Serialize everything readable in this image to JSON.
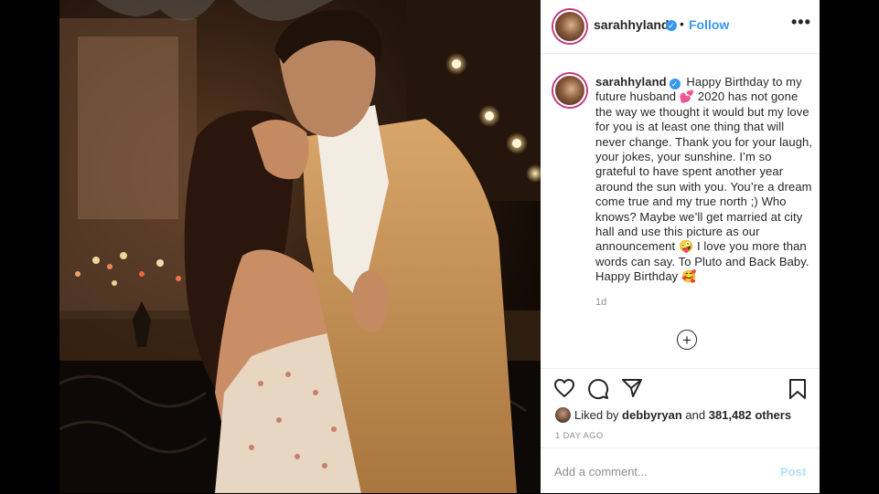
{
  "post": {
    "image_alt": "Couple embracing on a balcony with string lights",
    "next_icon": "chevron-right-icon"
  },
  "header": {
    "username": "sarahhyland",
    "verified_icon": "verified-badge-icon",
    "separator": "•",
    "follow_label": "Follow",
    "more_label": "•••"
  },
  "caption": {
    "username": "sarahhyland",
    "text_part1": " Happy Birthday to my future husband ",
    "emoji1": "💕",
    "text_part2": "  2020 has not gone the way we thought it would but my love for you is at least one thing that will never change. Thank you for your laugh, your jokes, your sunshine. I’m so grateful to have spent another year around the sun with you. You’re a dream come true and my true north ;) Who knows? Maybe we’ll get married at city hall and use this picture as our announcement ",
    "emoji2": "🤪",
    "text_part3": "  I love you more than words can say. To Pluto and Back Baby. Happy Birthday ",
    "emoji3": "🥰",
    "time_ago": "1d"
  },
  "load_more": {
    "label": "+"
  },
  "actions": {
    "like_icon": "heart-icon",
    "comment_icon": "comment-icon",
    "share_icon": "share-icon",
    "save_icon": "bookmark-icon"
  },
  "likes": {
    "prefix": "Liked by ",
    "user": "debbyryan",
    "middle": " and ",
    "count": "381,482 others"
  },
  "posted": "1 DAY AGO",
  "add_comment": {
    "placeholder": "Add a comment...",
    "post_label": "Post"
  },
  "colors": {
    "accent": "#3897f0",
    "post_disabled": "#b2dffc",
    "muted": "#8e8e8e"
  }
}
